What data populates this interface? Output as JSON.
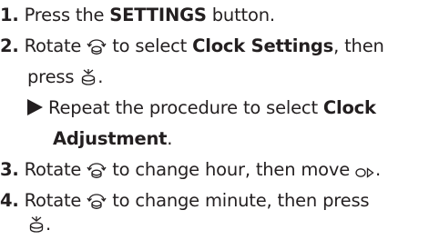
{
  "steps": [
    {
      "number": "1.",
      "t1": " Press the ",
      "b1": "SETTINGS",
      "t2": " button."
    },
    {
      "number": "2.",
      "t1": " Rotate ",
      "t2": " to select ",
      "b1": "Clock Settings",
      "t3": ", then",
      "line2_t1": "press ",
      "line2_t2": ".",
      "sub_t1": "Repeat the procedure to select ",
      "sub_b1": "Clock",
      "sub_b2": "Adjustment",
      "sub_t2": "."
    },
    {
      "number": "3.",
      "t1": " Rotate ",
      "t2": " to change hour, then move ",
      "t3": "."
    },
    {
      "number": "4.",
      "t1": " Rotate ",
      "t2": " to change minute, then press",
      "line2_t1": "."
    }
  ],
  "icons": {
    "rotate": "interface-dial-rotate-icon",
    "press": "interface-dial-press-icon",
    "move_right": "interface-dial-move-right-icon"
  },
  "colors": {
    "text": "#231f20"
  }
}
